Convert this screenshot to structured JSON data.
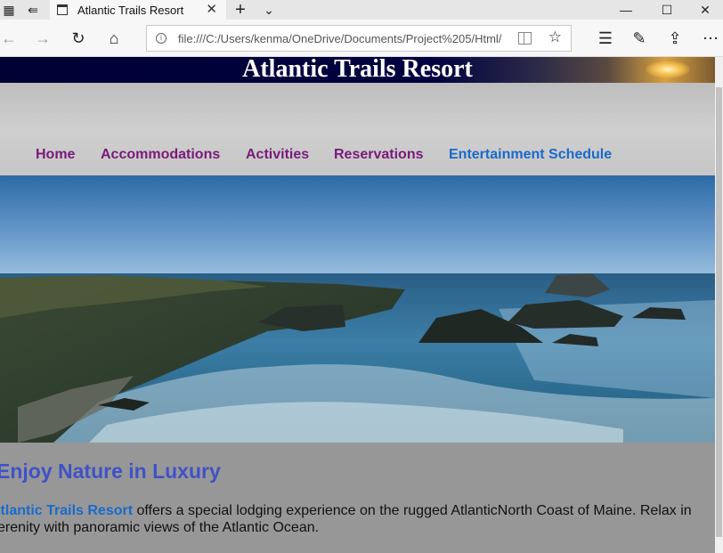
{
  "browser": {
    "tab_title": "Atlantic Trails Resort",
    "url": "file:///C:/Users/kenma/OneDrive/Documents/Project%205/Html/"
  },
  "page": {
    "banner_title": "Atlantic Trails Resort",
    "nav": [
      {
        "label": "Home"
      },
      {
        "label": "Accommodations"
      },
      {
        "label": "Activities"
      },
      {
        "label": "Reservations"
      },
      {
        "label": "Entertainment Schedule"
      }
    ],
    "heading": "Enjoy Nature in Luxury",
    "intro_brand": "Atlantic Trails Resort",
    "intro_text": " offers a special lodging experience on the rugged AtlanticNorth Coast of Maine. Relax in serenity with panoramic views of the Atlantic Ocean."
  },
  "colors": {
    "nav_link": "#7a1a7a",
    "nav_link_active": "#1a6acb",
    "heading": "#3f52c8",
    "banner_bg": "#000033"
  }
}
